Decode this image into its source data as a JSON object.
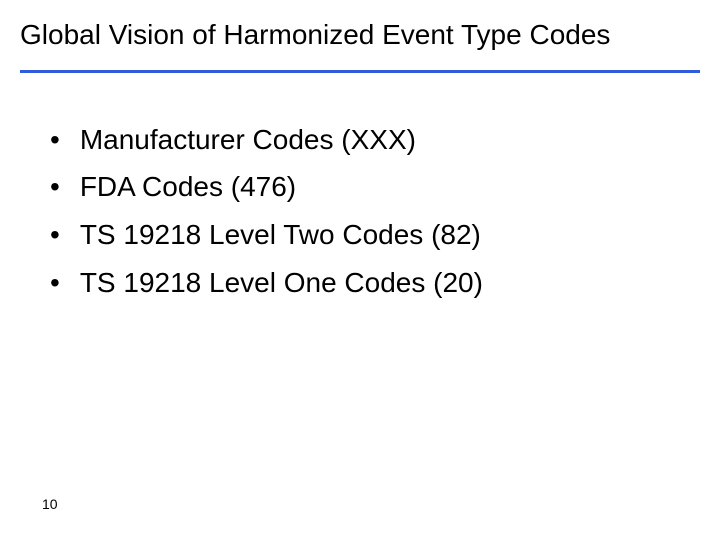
{
  "title": "Global Vision of Harmonized Event Type Codes",
  "bullets": [
    "Manufacturer Codes (XXX)",
    "FDA Codes (476)",
    "TS 19218 Level Two Codes (82)",
    "TS 19218 Level One Codes (20)"
  ],
  "page_number": "10"
}
